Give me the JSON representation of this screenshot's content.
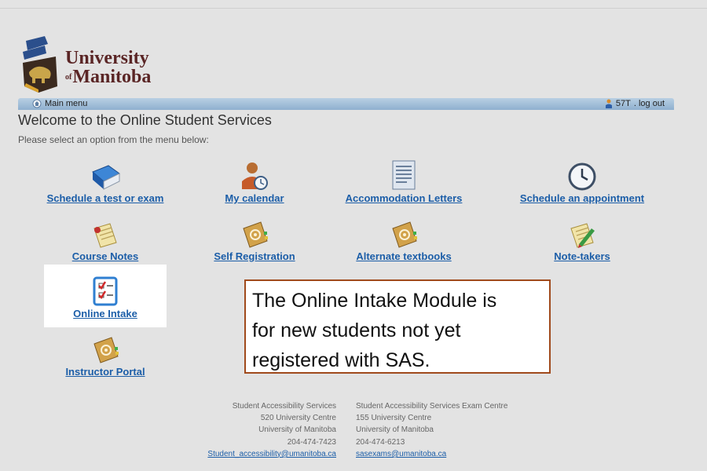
{
  "brand": {
    "line1": "University",
    "of": "of",
    "line2": "Manitoba"
  },
  "menubar": {
    "main_menu": "Main menu",
    "user_id": "57T",
    "logout": ". log out"
  },
  "welcome": "Welcome to the Online Student Services",
  "subtitle": "Please select an option from the menu below:",
  "tiles": [
    {
      "label": "Schedule a test or exam",
      "icon": "book-icon"
    },
    {
      "label": "My calendar",
      "icon": "user-clock-icon"
    },
    {
      "label": "Accommodation Letters",
      "icon": "document-icon"
    },
    {
      "label": "Schedule an appointment",
      "icon": "clock-icon"
    },
    {
      "label": "Course Notes",
      "icon": "notepad-icon"
    },
    {
      "label": "Self Registration",
      "icon": "address-book-icon"
    },
    {
      "label": "Alternate textbooks",
      "icon": "address-book-icon"
    },
    {
      "label": "Note-takers",
      "icon": "notepad-pencil-icon"
    },
    {
      "label": "Online Intake",
      "icon": "checklist-icon"
    },
    {
      "label": "Instructor Portal",
      "icon": "address-book-icon"
    }
  ],
  "callout": {
    "line1": "The Online Intake Module is",
    "line2": "for new students not yet",
    "line3": "registered with SAS."
  },
  "footer": {
    "left": {
      "name": "Student Accessibility Services",
      "room": "520 University Centre",
      "institution": "University of Manitoba",
      "phone": "204-474-7423",
      "email": "Student_accessibility@umanitoba.ca"
    },
    "right": {
      "name": "Student Accessibility Services Exam Centre",
      "room": "155 University Centre",
      "institution": "University of Manitoba",
      "phone": "204-474-6213",
      "email": "sasexams@umanitoba.ca"
    }
  },
  "colors": {
    "link": "#1c5ea8",
    "brand": "#5a2525",
    "callout_border": "#a04a1c",
    "menubar": "#a6c2dc"
  }
}
